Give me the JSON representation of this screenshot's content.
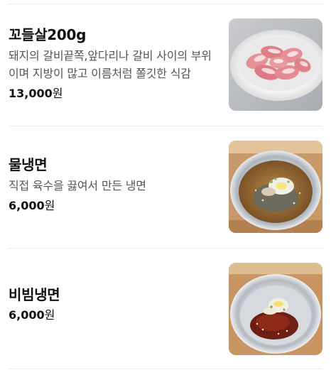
{
  "menu": {
    "currency_suffix": "원",
    "items": [
      {
        "name": "꼬들살200g",
        "description": "돼지의 갈비끝쪽,앞다리나 갈비 사이의 부위이며 지방이 많고 이름처럼 쫄깃한 식감",
        "price": "13,000",
        "image": "sliced-pork-plate-photo"
      },
      {
        "name": "물냉면",
        "description": "직접 육수을 끓여서 만든 냉면",
        "price": "6,000",
        "image": "cold-broth-noodles-photo"
      },
      {
        "name": "비빔냉면",
        "description": "",
        "price": "6,000",
        "image": "spicy-mixed-noodles-photo"
      }
    ]
  }
}
